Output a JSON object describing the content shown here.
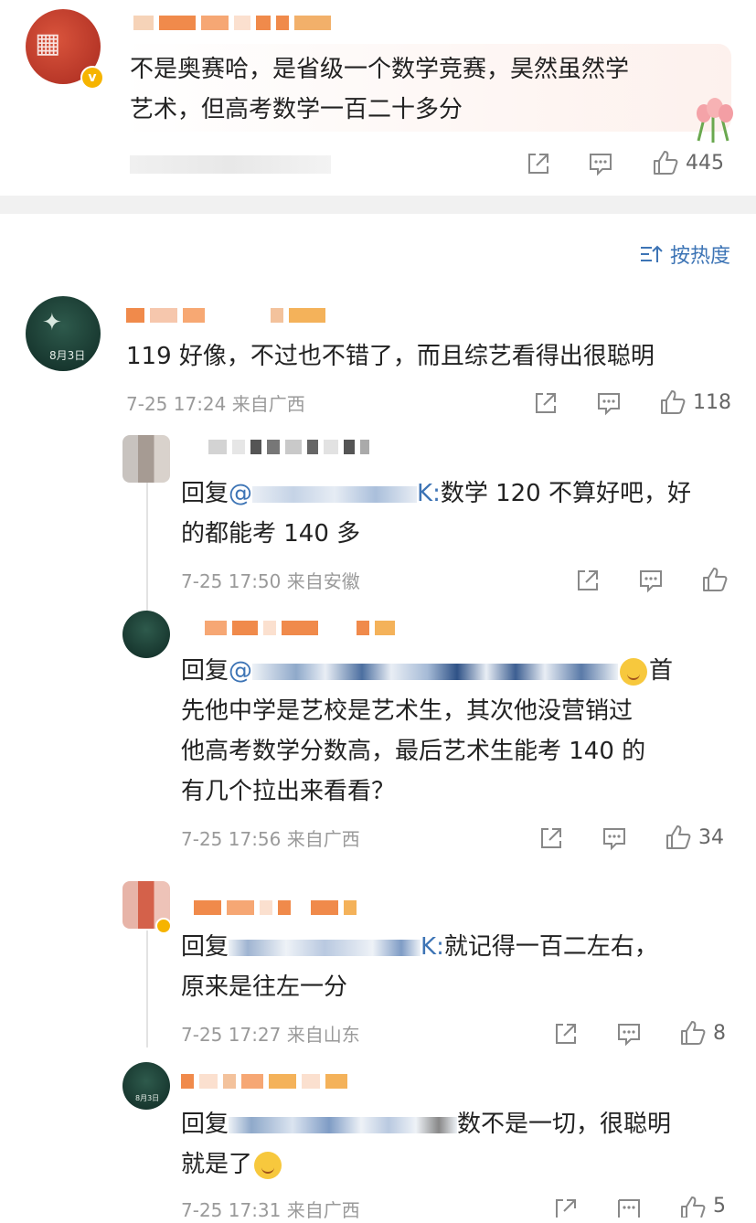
{
  "colors": {
    "accent": "#3d74b5",
    "meta_gray": "#9a9a9a",
    "divider": "#f1f1f1",
    "verified": "#f6b400"
  },
  "top_post": {
    "text_line1": "不是奥赛哈，是省级一个数学竞赛，昊然虽然学",
    "text_line2": "艺术，但高考数学一百二十多分",
    "likes": "445",
    "icons": [
      "share-icon",
      "comment-icon",
      "like-icon"
    ]
  },
  "sort": {
    "label": "按热度",
    "icon": "sort-icon"
  },
  "comments": [
    {
      "text": "119 好像，不过也不错了，而且综艺看得出很聪明",
      "meta": "7-25 17:24  来自广西",
      "likes": "118"
    }
  ],
  "replies": [
    {
      "prefix": "回复",
      "at": "@",
      "mention_tail": "K:",
      "text_line1": "数学 120 不算好吧，好",
      "text_line2": "的都能考 140 多",
      "meta": "7-25 17:50  来自安徽",
      "likes": ""
    },
    {
      "prefix": "回复",
      "at": "@",
      "text_line1_tail": "首",
      "text_line2": "先他中学是艺校是艺术生，其次他没营销过",
      "text_line3": "他高考数学分数高，最后艺术生能考 140 的",
      "text_line4": "有几个拉出来看看？",
      "meta": "7-25 17:56  来自广西",
      "likes": "34"
    },
    {
      "prefix": "回复",
      "mention_tail": "K:",
      "text_line1": "就记得一百二左右，",
      "text_line2": "原来是往左一分",
      "meta": "7-25 17:27  来自山东",
      "likes": "8"
    },
    {
      "prefix": "回复",
      "text_line1_tail": "数不是一切，很聪明",
      "text_line2": "就是了",
      "meta": "7-25 17:31  来自广西",
      "likes": "5"
    }
  ]
}
